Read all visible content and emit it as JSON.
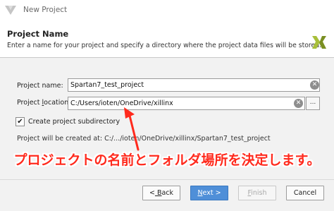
{
  "window": {
    "title": "New Project"
  },
  "header": {
    "title": "Project Name",
    "description": "Enter a name for your project and specify a directory where the project data files will be stored."
  },
  "form": {
    "name_label": "Project name:",
    "name_value": "Spartan7_test_project",
    "location_label_pre": "Project ",
    "location_label_u": "l",
    "location_label_post": "ocation:",
    "location_value": "C:/Users/ioten/OneDrive/xillinx",
    "browse_label": "...",
    "subdir_checkbox_checked": true,
    "subdir_label": "Create project subdirectory",
    "created_at_text": "Project will be created at: C:/.../ioten/OneDrive/xillinx/Spartan7_test_project"
  },
  "annotation": {
    "text": "プロジェクトの名前とフォルダ場所を決定します。",
    "color": "#ff2a1d"
  },
  "buttons": {
    "back_arrow": "<",
    "back_u": " B",
    "back_rest": "ack",
    "next_u": "N",
    "next_rest": "ext >",
    "finish_u": "F",
    "finish_rest": "inish",
    "cancel": "Cancel"
  },
  "icons": {
    "app": "vivado-logo-icon",
    "brand": "xilinx-logo-icon",
    "clear": "clear-icon",
    "check": "checkmark-icon"
  },
  "colors": {
    "accent": "#4f8fd8",
    "annotation": "#ff2a1d"
  }
}
